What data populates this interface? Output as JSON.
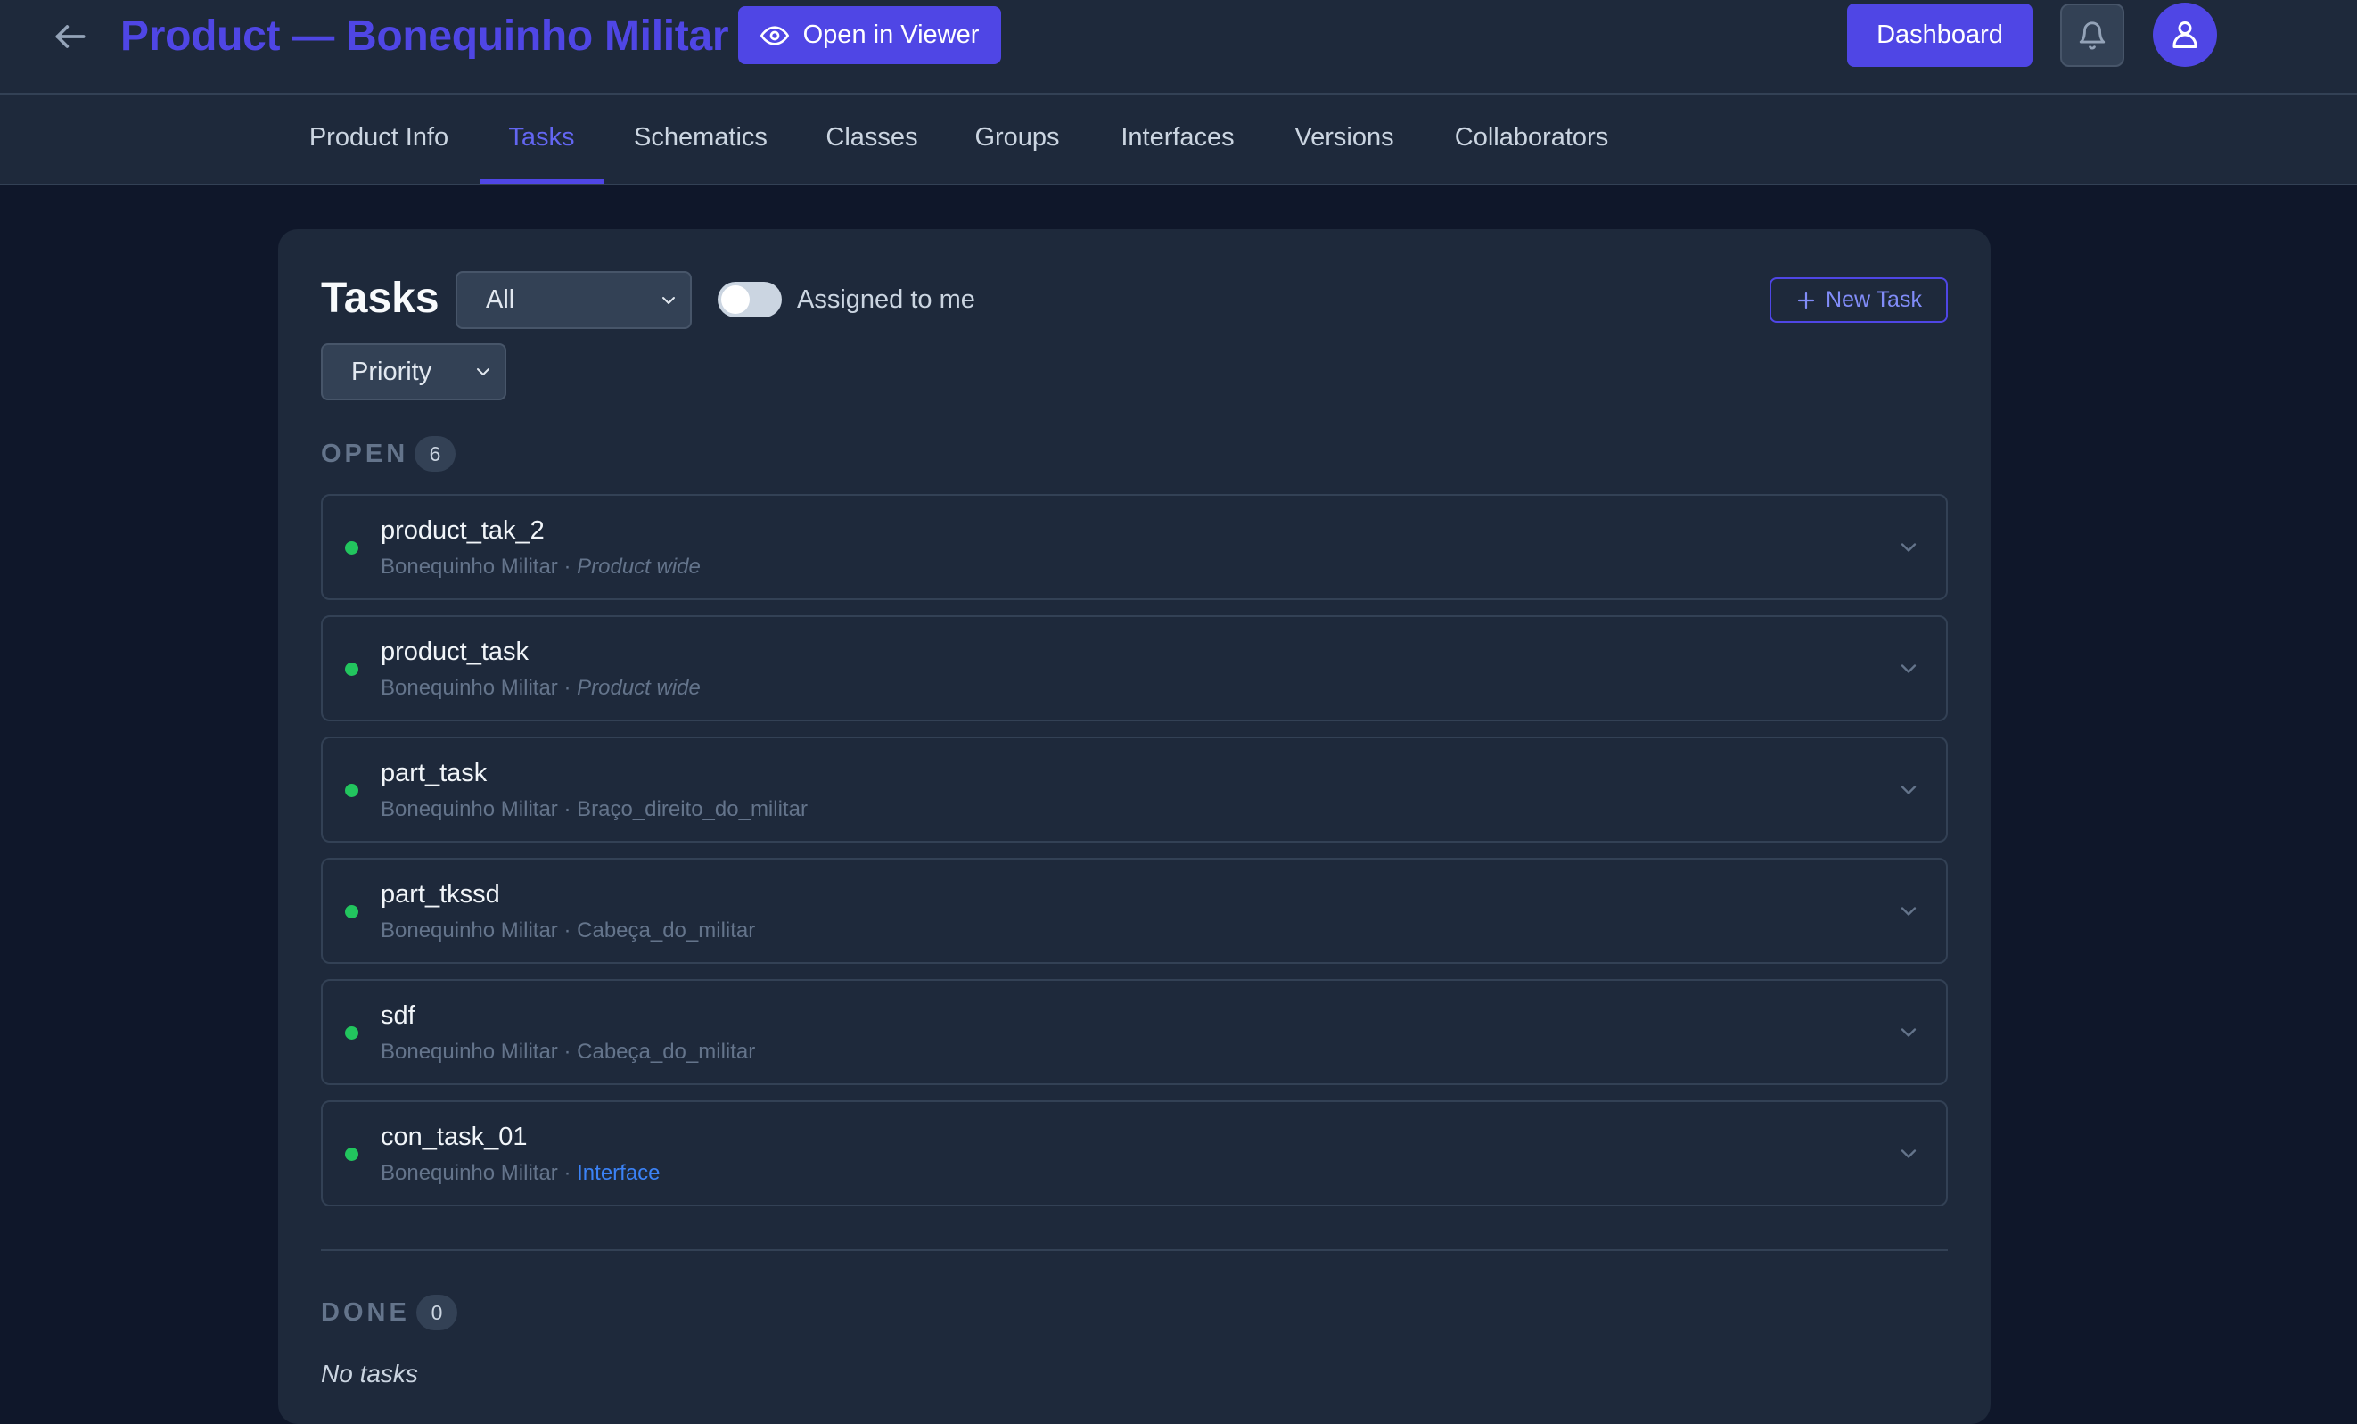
{
  "header": {
    "title": "Product — Bonequinho Militar",
    "open_viewer_label": "Open in Viewer",
    "dashboard_label": "Dashboard"
  },
  "tabs": [
    {
      "label": "Product Info",
      "active": false
    },
    {
      "label": "Tasks",
      "active": true
    },
    {
      "label": "Schematics",
      "active": false
    },
    {
      "label": "Classes",
      "active": false
    },
    {
      "label": "Groups",
      "active": false
    },
    {
      "label": "Interfaces",
      "active": false
    },
    {
      "label": "Versions",
      "active": false
    },
    {
      "label": "Collaborators",
      "active": false
    }
  ],
  "tasks_panel": {
    "heading": "Tasks",
    "filter_select": "All",
    "assigned_toggle_label": "Assigned to me",
    "assigned_toggle_on": false,
    "sort_select": "Priority",
    "new_task_label": "New Task"
  },
  "open_section": {
    "label": "OPEN",
    "count": "6",
    "tasks": [
      {
        "name": "product_tak_2",
        "product": "Bonequinho Militar",
        "separator": "·",
        "scope": "Product wide",
        "scope_style": "italic"
      },
      {
        "name": "product_task",
        "product": "Bonequinho Militar",
        "separator": "·",
        "scope": "Product wide",
        "scope_style": "italic"
      },
      {
        "name": "part_task",
        "product": "Bonequinho Militar",
        "separator": "·",
        "scope": "Braço_direito_do_militar",
        "scope_style": "plain"
      },
      {
        "name": "part_tkssd",
        "product": "Bonequinho Militar",
        "separator": "·",
        "scope": "Cabeça_do_militar",
        "scope_style": "plain"
      },
      {
        "name": "sdf",
        "product": "Bonequinho Militar",
        "separator": "·",
        "scope": "Cabeça_do_militar",
        "scope_style": "plain"
      },
      {
        "name": "con_task_01",
        "product": "Bonequinho Militar",
        "separator": "·",
        "scope": "Interface",
        "scope_style": "link"
      }
    ]
  },
  "done_section": {
    "label": "DONE",
    "count": "0",
    "empty_text": "No tasks"
  },
  "colors": {
    "accent": "#4f46e5",
    "background": "#0f172a",
    "surface": "#1e293b",
    "status_open": "#22c55e",
    "link": "#3b82f6"
  },
  "icons": {
    "back": "arrow-left-icon",
    "viewer": "eye-icon",
    "notifications": "bell-icon",
    "profile": "user-icon",
    "new_task": "plus-icon",
    "expand": "chevron-down-icon"
  }
}
